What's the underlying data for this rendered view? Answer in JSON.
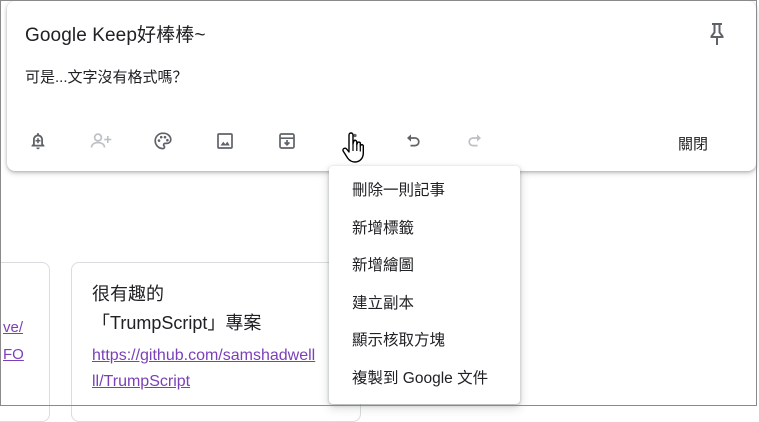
{
  "note": {
    "title": "Google Keep好棒棒~",
    "body": "可是...文字沒有格式嗎？"
  },
  "toolbar": {
    "icons": [
      "reminder-icon",
      "collaborator-icon",
      "palette-icon",
      "image-icon",
      "archive-icon",
      "more-icon",
      "undo-icon",
      "redo-icon"
    ],
    "close_label": "關閉"
  },
  "menu": {
    "items": [
      {
        "label": "刪除一則記事"
      },
      {
        "label": "新增標籤"
      },
      {
        "label": "新增繪圖"
      },
      {
        "label": "建立副本"
      },
      {
        "label": "顯示核取方塊"
      },
      {
        "label": "複製到 Google 文件"
      }
    ]
  },
  "background_notes": {
    "left_fragments": [
      "ve/",
      "FO"
    ],
    "middle_title_line1": "很有趣的",
    "middle_title_line2": "「TrumpScript」專案",
    "middle_link_line1": "https://github.com/samshadwell",
    "middle_link_line2": "ll/TrumpScript"
  },
  "colors": {
    "text": "#202124",
    "icon": "#5f6368",
    "icon_disabled": "#bdc1c6",
    "link": "#7b3fb8",
    "border": "#dadce0"
  }
}
